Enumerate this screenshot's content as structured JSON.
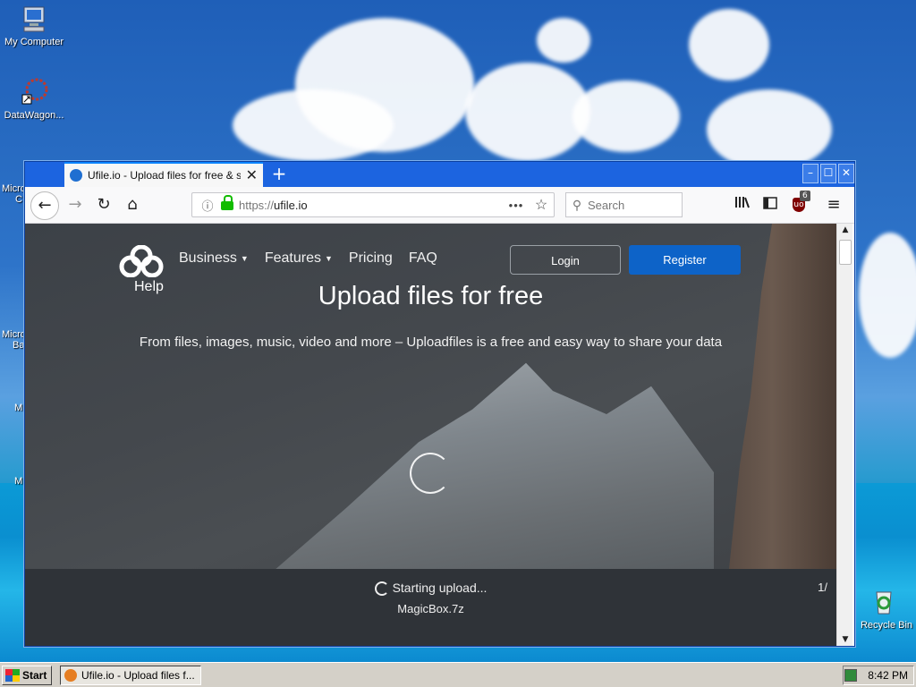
{
  "desktop": {
    "icons": [
      {
        "label": "My Computer"
      },
      {
        "label": "DataWagon..."
      },
      {
        "label": "Recycle Bin"
      }
    ],
    "partial_labels": [
      "Micro",
      "C",
      "Micro",
      "Ba",
      "M",
      "M"
    ]
  },
  "browser": {
    "tab": {
      "title": "Ufile.io - Upload files for free & sh",
      "close": "✕"
    },
    "new_tab": "+",
    "window_buttons": [
      "–",
      "☐",
      "✕"
    ],
    "url": {
      "protocol": "https://",
      "host": "ufile.io"
    },
    "url_more": "•••",
    "search_placeholder": "Search",
    "ublock_count": "6"
  },
  "site": {
    "nav": [
      {
        "label": "Business",
        "dropdown": true
      },
      {
        "label": "Features",
        "dropdown": true
      },
      {
        "label": "Pricing",
        "dropdown": false
      },
      {
        "label": "FAQ",
        "dropdown": false
      }
    ],
    "help_label": "Help",
    "login_label": "Login",
    "register_label": "Register",
    "headline": "Upload files for free",
    "subline": "From files, images, music, video and more – Uploadfiles is a free and easy way to share your data",
    "upload": {
      "status": "Starting upload...",
      "filename": "MagicBox.7z",
      "count": "1/"
    }
  },
  "taskbar": {
    "start_label": "Start",
    "task_label": "Ufile.io - Upload files f...",
    "clock": "8:42 PM"
  },
  "colors": {
    "accent": "#0d63c8",
    "titlebar": "#1c64e0",
    "lock_green": "#12bc00"
  }
}
